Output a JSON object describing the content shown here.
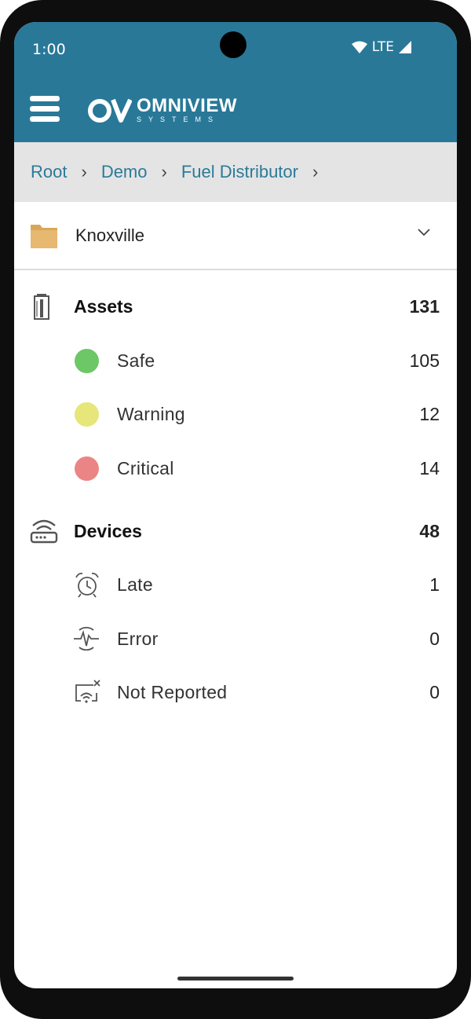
{
  "status_bar": {
    "time": "1:00",
    "network": "LTE"
  },
  "header": {
    "logo_main": "OMNIVIEW",
    "logo_sub": "SYSTEMS"
  },
  "breadcrumb": [
    "Root",
    "Demo",
    "Fuel Distributor"
  ],
  "location": {
    "label": "Knoxville"
  },
  "assets": {
    "label": "Assets",
    "count": "131",
    "items": [
      {
        "label": "Safe",
        "count": "105",
        "color": "#6dc766"
      },
      {
        "label": "Warning",
        "count": "12",
        "color": "#e6e67a"
      },
      {
        "label": "Critical",
        "count": "14",
        "color": "#eb8585"
      }
    ]
  },
  "devices": {
    "label": "Devices",
    "count": "48",
    "items": [
      {
        "label": "Late",
        "count": "1",
        "icon": "alarm-clock-icon"
      },
      {
        "label": "Error",
        "count": "0",
        "icon": "error-pulse-icon"
      },
      {
        "label": "Not Reported",
        "count": "0",
        "icon": "no-signal-icon"
      }
    ]
  },
  "colors": {
    "appbar": "#297898",
    "breadcrumb_link": "#2b7a98",
    "folder": "#e0b066"
  }
}
